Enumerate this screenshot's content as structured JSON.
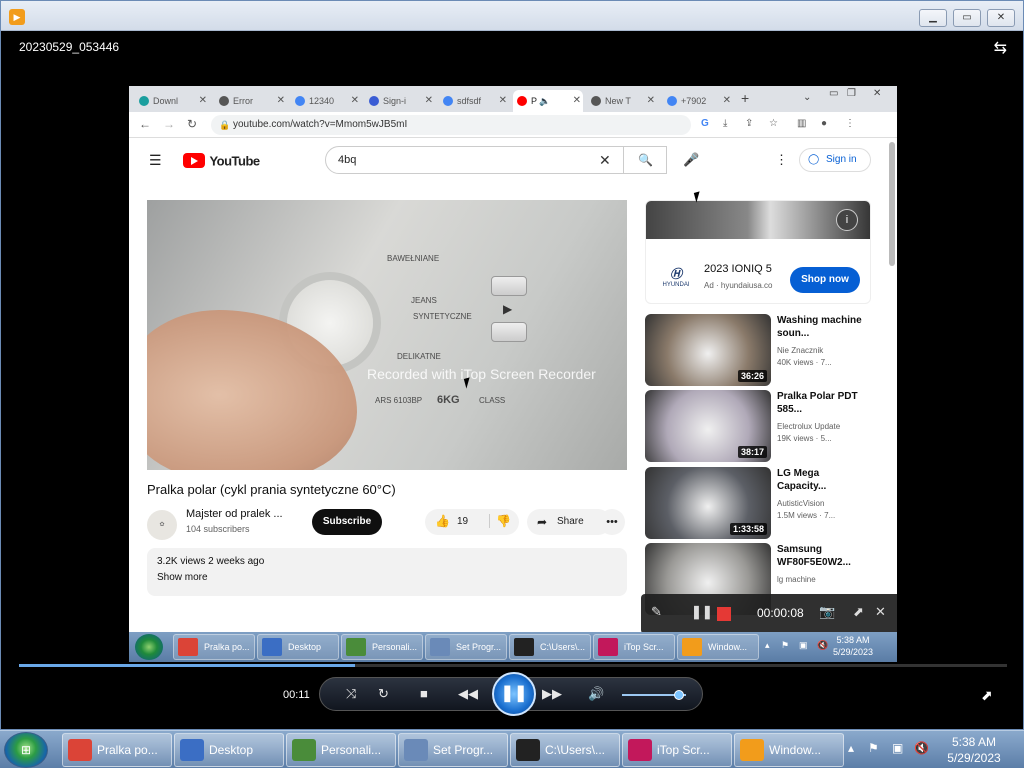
{
  "player": {
    "filename": "20230529_053446",
    "elapsed": "00:11",
    "progress_fraction": 0.34,
    "volume_fraction": 0.9
  },
  "browser": {
    "tabs": [
      {
        "label": "Downl",
        "favicon_color": "#1a9e9e"
      },
      {
        "label": "Error",
        "favicon_color": "#555555"
      },
      {
        "label": "12340",
        "favicon_color": "#4285f4"
      },
      {
        "label": "Sign-i",
        "favicon_color": "#3a5cd4"
      },
      {
        "label": "sdfsdf",
        "favicon_color": "#4285f4"
      },
      {
        "label": "P",
        "favicon_color": "#ff0000"
      },
      {
        "label": "New T",
        "favicon_color": "#555555"
      },
      {
        "label": "+7902",
        "favicon_color": "#4285f4"
      }
    ],
    "url": "youtube.com/watch?v=Mmom5wJB5mI"
  },
  "youtube": {
    "logo_text": "YouTube",
    "search_value": "4bq",
    "sign_in": "Sign in",
    "video_title": "Pralka polar (cykl prania syntetyczne 60°C)",
    "channel_name": "Majster od pralek ...",
    "subscribers": "104 subscribers",
    "subscribe": "Subscribe",
    "likes": "19",
    "share": "Share",
    "views_date": "3.2K views  2 weeks ago",
    "show_more": "Show more",
    "machine_labels": {
      "bawelniane": "BAWEŁNIANE",
      "jeans": "JEANS",
      "syntetyczne": "SYNTETYCZNE",
      "delikatne": "DELIKATNE",
      "model": "ARS 6103BP",
      "capacity": "6KG",
      "class": "CLASS"
    },
    "watermark": "Recorded with iTop Screen Recorder",
    "ad": {
      "title": "2023 IONIQ 5",
      "meta": "Ad · hyundaiusa.co",
      "brand": "HYUNDAI",
      "button": "Shop now"
    },
    "recommendations": [
      {
        "title": "Washing machine soun...",
        "channel": "Nie Znacznik",
        "views": "40K views · 7...",
        "duration": "36:26",
        "thumb": "#8a7a6a"
      },
      {
        "title": "Pralka Polar PDT 585...",
        "channel": "Electrolux Update",
        "views": "19K views · 5...",
        "duration": "38:17",
        "thumb": "#b0a9b8"
      },
      {
        "title": "LG Mega Capacity...",
        "channel": "AutisticVision",
        "views": "1.5M views · 7...",
        "duration": "1:33:58",
        "thumb": "#5c5f66"
      },
      {
        "title": "Samsung WF80F5E0W2...",
        "channel": "lg machine",
        "views": "",
        "duration": "",
        "thumb": "#9a9996"
      }
    ]
  },
  "recorder": {
    "timer": "00:00:08"
  },
  "inner_taskbar": {
    "items": [
      {
        "label": "Pralka po...",
        "color": "#db4437"
      },
      {
        "label": "Desktop",
        "color": "#3b6ec4"
      },
      {
        "label": "Personali...",
        "color": "#4a8c3a"
      },
      {
        "label": "Set Progr...",
        "color": "#6a8ab8"
      },
      {
        "label": "C:\\Users\\...",
        "color": "#222222"
      },
      {
        "label": "iTop Scr...",
        "color": "#c2185b"
      },
      {
        "label": "Window...",
        "color": "#f29c1b"
      }
    ],
    "time": "5:38 AM",
    "date": "5/29/2023"
  },
  "taskbar": {
    "items": [
      {
        "label": "Pralka po...",
        "color": "#db4437"
      },
      {
        "label": "Desktop",
        "color": "#3b6ec4"
      },
      {
        "label": "Personali...",
        "color": "#4a8c3a"
      },
      {
        "label": "Set Progr...",
        "color": "#6a8ab8"
      },
      {
        "label": "C:\\Users\\...",
        "color": "#222222"
      },
      {
        "label": "iTop Scr...",
        "color": "#c2185b"
      },
      {
        "label": "Window...",
        "color": "#f29c1b"
      }
    ],
    "time": "5:38 AM",
    "date": "5/29/2023"
  }
}
